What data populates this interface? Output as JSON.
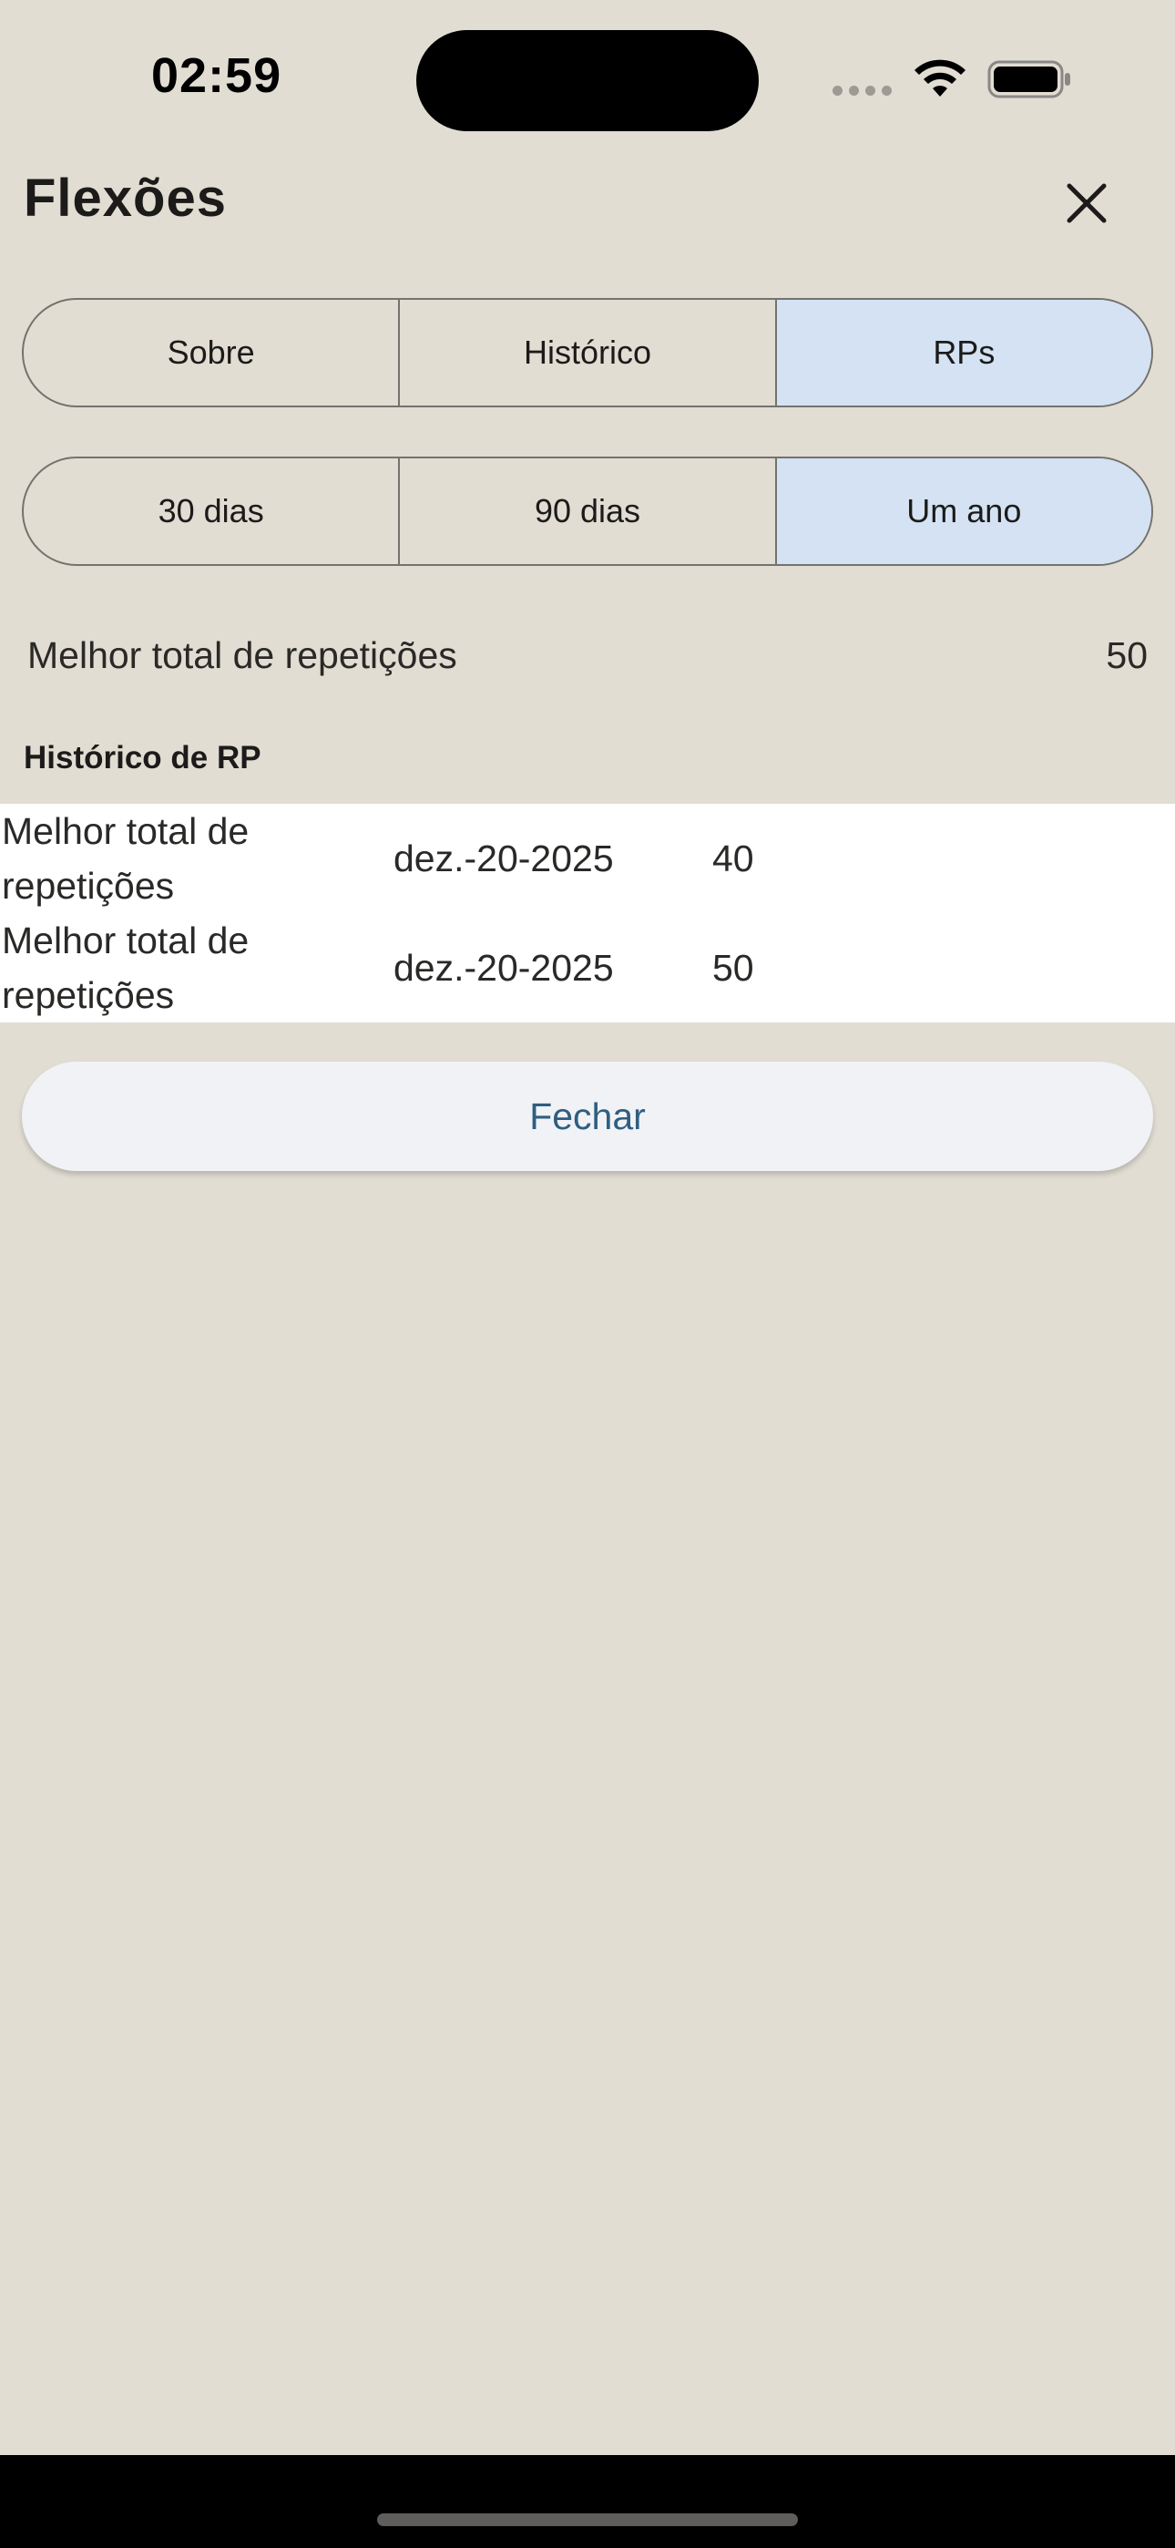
{
  "status_bar": {
    "time": "02:59"
  },
  "header": {
    "title": "Flexões",
    "close_icon": "close-icon"
  },
  "tabs": [
    {
      "label": "Sobre",
      "selected": false
    },
    {
      "label": "Histórico",
      "selected": false
    },
    {
      "label": "RPs",
      "selected": true
    }
  ],
  "ranges": [
    {
      "label": "30 dias",
      "selected": false
    },
    {
      "label": "90 dias",
      "selected": false
    },
    {
      "label": "Um ano",
      "selected": true
    }
  ],
  "best": {
    "label": "Melhor total de repetições",
    "value": "50"
  },
  "history": {
    "heading": "Histórico de RP",
    "rows": [
      {
        "label": "Melhor total de repetições",
        "date": "dez.-20-2025",
        "value": "40"
      },
      {
        "label": "Melhor total de repetições",
        "date": "dez.-20-2025",
        "value": "50"
      }
    ]
  },
  "actions": {
    "close_label": "Fechar"
  },
  "colors": {
    "background": "#e1ddd3",
    "selected_segment": "#d4e2f3",
    "button_text": "#2f5e80"
  }
}
